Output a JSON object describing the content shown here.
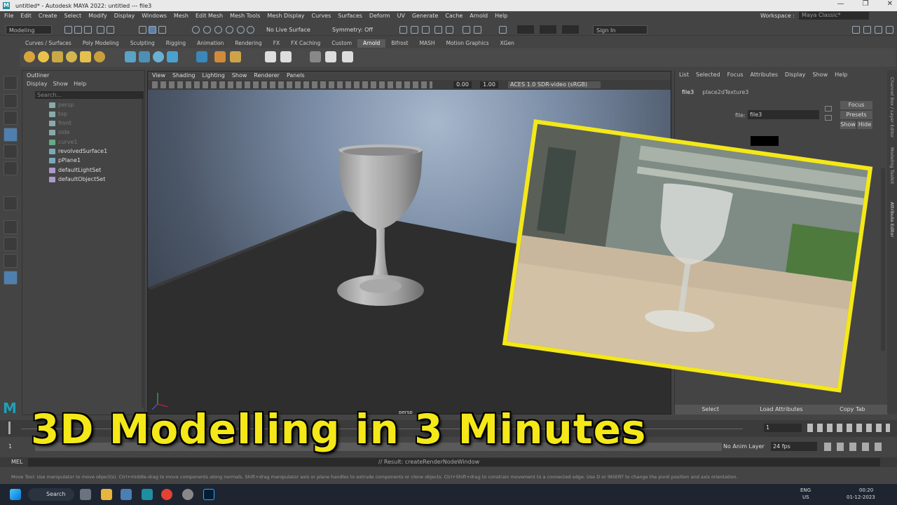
{
  "window": {
    "title": "untitled* - Autodesk MAYA 2022: untitled   ---   file3",
    "controls": [
      "—",
      "❐",
      "✕"
    ]
  },
  "menubar": {
    "items": [
      "File",
      "Edit",
      "Create",
      "Select",
      "Modify",
      "Display",
      "Windows",
      "Mesh",
      "Edit Mesh",
      "Mesh Tools",
      "Mesh Display",
      "Curves",
      "Surfaces",
      "Deform",
      "UV",
      "Generate",
      "Cache",
      "Arnold",
      "Help"
    ],
    "workspace_label": "Workspace :",
    "workspace_value": "Maya Classic*"
  },
  "toolbar": {
    "mode": "Modeling",
    "live_surface": "No Live Surface",
    "symmetry": "Symmetry: Off",
    "sign_in": "Sign In"
  },
  "shelf_tabs": [
    "Curves / Surfaces",
    "Poly Modeling",
    "Sculpting",
    "Rigging",
    "Animation",
    "Rendering",
    "FX",
    "FX Caching",
    "Custom",
    "Arnold",
    "Bifrost",
    "MASH",
    "Motion Graphics",
    "XGen"
  ],
  "shelf_active": "Arnold",
  "outliner": {
    "title": "Outliner",
    "menu": [
      "Display",
      "Show",
      "Help"
    ],
    "search_placeholder": "Search...",
    "items": [
      {
        "label": "persp",
        "dim": true
      },
      {
        "label": "top",
        "dim": true
      },
      {
        "label": "front",
        "dim": true
      },
      {
        "label": "side",
        "dim": true
      },
      {
        "label": "curve1",
        "dim": true
      },
      {
        "label": "revolvedSurface1",
        "dim": false
      },
      {
        "label": "pPlane1",
        "dim": false
      },
      {
        "label": "defaultLightSet",
        "dim": false
      },
      {
        "label": "defaultObjectSet",
        "dim": false
      }
    ]
  },
  "viewport": {
    "menu": [
      "View",
      "Shading",
      "Lighting",
      "Show",
      "Renderer",
      "Panels"
    ],
    "exposure": "0.00",
    "gamma": "1.00",
    "color_space": "ACES 1.0 SDR-video (sRGB)",
    "camera_label": "persp"
  },
  "attribute_editor": {
    "menu": [
      "List",
      "Selected",
      "Focus",
      "Attributes",
      "Display",
      "Show",
      "Help"
    ],
    "tabs": [
      "file3",
      "place2dTexture3"
    ],
    "file_label": "file:",
    "file_value": "file3",
    "focus_btn": "Focus",
    "presets_btn": "Presets",
    "show_btn": "Show",
    "hide_btn": "Hide",
    "bottom_buttons": [
      "Select",
      "Load Attributes",
      "Copy Tab"
    ]
  },
  "right_strip": [
    "Channel Box / Layer Editor",
    "Modeling Toolkit",
    "Attribute Editor"
  ],
  "timeline": {
    "start": "1",
    "current": "1",
    "range_start": "1",
    "anim_layer": "No Anim Layer",
    "fps": "24 fps"
  },
  "mel": {
    "label": "MEL",
    "result": "// Result: createRenderNodeWindow"
  },
  "helpline": "Move Tool: Use manipulator to move object(s). Ctrl+middle-drag to move components along normals. Shift+drag manipulator axis or plane handles to extrude components or clone objects. Ctrl+Shift+drag to constrain movement to a connected edge. Use D or INSERT to change the pivot position and axis orientation.",
  "taskbar": {
    "search": "Search",
    "lang": "ENG",
    "region": "US",
    "time": "00:20",
    "date": "01-12-2023"
  },
  "banner": "3D Modelling in 3 Minutes",
  "colors": {
    "banner": "#f4e818",
    "maya_bg": "#444444",
    "viewport_top": "#a7b8cc",
    "floor": "#2e2e2e"
  }
}
